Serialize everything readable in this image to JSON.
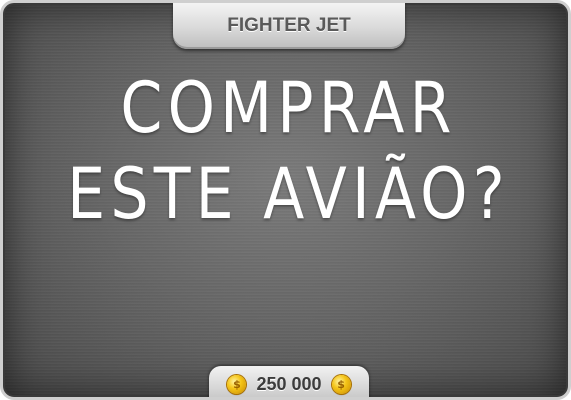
{
  "dialog": {
    "title": "FIGHTER JET",
    "question_line1": "COMPRAR",
    "question_line2": "ESTE AVIÃO?",
    "price": "250 000",
    "coin_symbol": "$",
    "icons": [
      "coin-icon"
    ],
    "colors": {
      "panel": "#666666",
      "text": "#ffffff",
      "coin": "#f5c518"
    }
  }
}
